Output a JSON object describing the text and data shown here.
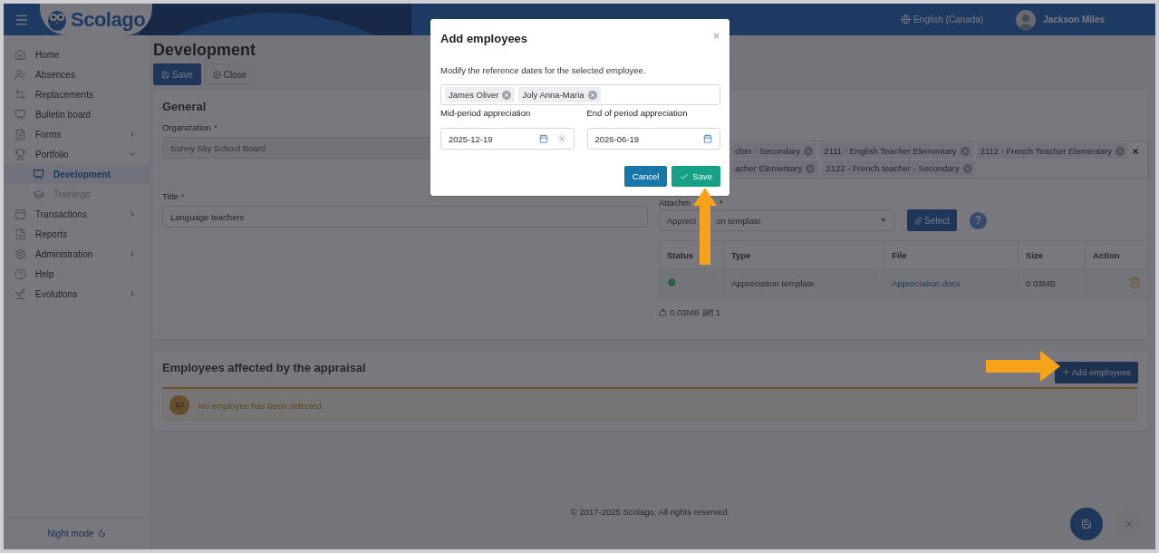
{
  "header": {
    "brand": "Scolago",
    "language": "English (Canada)",
    "user": "Jackson Miles"
  },
  "sidebar": {
    "items": [
      {
        "label": "Home",
        "selected": false
      },
      {
        "label": "Absences",
        "selected": false
      },
      {
        "label": "Replacements",
        "selected": false
      },
      {
        "label": "Bulletin board",
        "selected": false
      },
      {
        "label": "Forms",
        "selected": false,
        "expanded": false
      },
      {
        "label": "Portfolio",
        "selected": false,
        "expanded": true,
        "children": [
          {
            "label": "Development",
            "selected": true
          },
          {
            "label": "Trainings",
            "selected": false,
            "disabled": true
          }
        ]
      },
      {
        "label": "Transactions",
        "selected": false,
        "expanded": false
      },
      {
        "label": "Reports",
        "selected": false
      },
      {
        "label": "Administration",
        "selected": false,
        "expanded": false
      },
      {
        "label": "Help",
        "selected": false
      },
      {
        "label": "Evolutions",
        "selected": false,
        "expanded": false
      }
    ],
    "night_mode": "Night mode"
  },
  "page": {
    "title": "Development",
    "actions": [
      {
        "label": "Save",
        "kind": "primary"
      },
      {
        "label": "Close",
        "kind": "secondary"
      }
    ]
  },
  "general": {
    "heading": "General",
    "organization": {
      "label": "Organization",
      "required_mark": "*",
      "value": "Sunny Sky School Board",
      "disabled": true
    },
    "jobs": {
      "rows": [
        [
          "cher - Secondary",
          "2111 - English Teacher Elementary",
          "2112 - French Teacher Elementary"
        ],
        [
          "acher Elementary",
          "2122 - French teacher - Secondary"
        ]
      ]
    },
    "title_field": {
      "label": "Title",
      "required_mark": "*",
      "value": "Language teachers"
    },
    "attachments": {
      "label_parts": [
        "Attachm"
      ],
      "required_mark": "*",
      "select_value_parts": [
        "Appreci",
        "on template"
      ],
      "select_button": "Select",
      "help": "?",
      "columns": [
        "Status",
        "Type",
        "File",
        "Size",
        "Action"
      ],
      "rows": [
        {
          "valid": true,
          "type": "Appreciation template",
          "file": "Appreciation.docx",
          "size": "0.03MB"
        }
      ],
      "total_size": "0.03MB",
      "count": "1"
    }
  },
  "employees": {
    "heading": "Employees affected by the appraisal",
    "add_button": "Add employees",
    "alert": "No employee has been selected."
  },
  "footer": "© 2017-2025 Scolago. All rights reserved.",
  "modal": {
    "title": "Add employees",
    "description": "Modify the reference dates for the selected employee.",
    "employees": [
      "James Oliver",
      "Joly Anna-Maria"
    ],
    "fields": [
      {
        "label": "Mid-period appreciation",
        "value": "2025-12-19",
        "clearable": true
      },
      {
        "label": "End of period appreciation",
        "value": "2026-06-19",
        "clearable": false
      }
    ],
    "buttons": [
      {
        "label": "Cancel",
        "kind": "secondary"
      },
      {
        "label": "Save",
        "kind": "primary"
      }
    ]
  }
}
